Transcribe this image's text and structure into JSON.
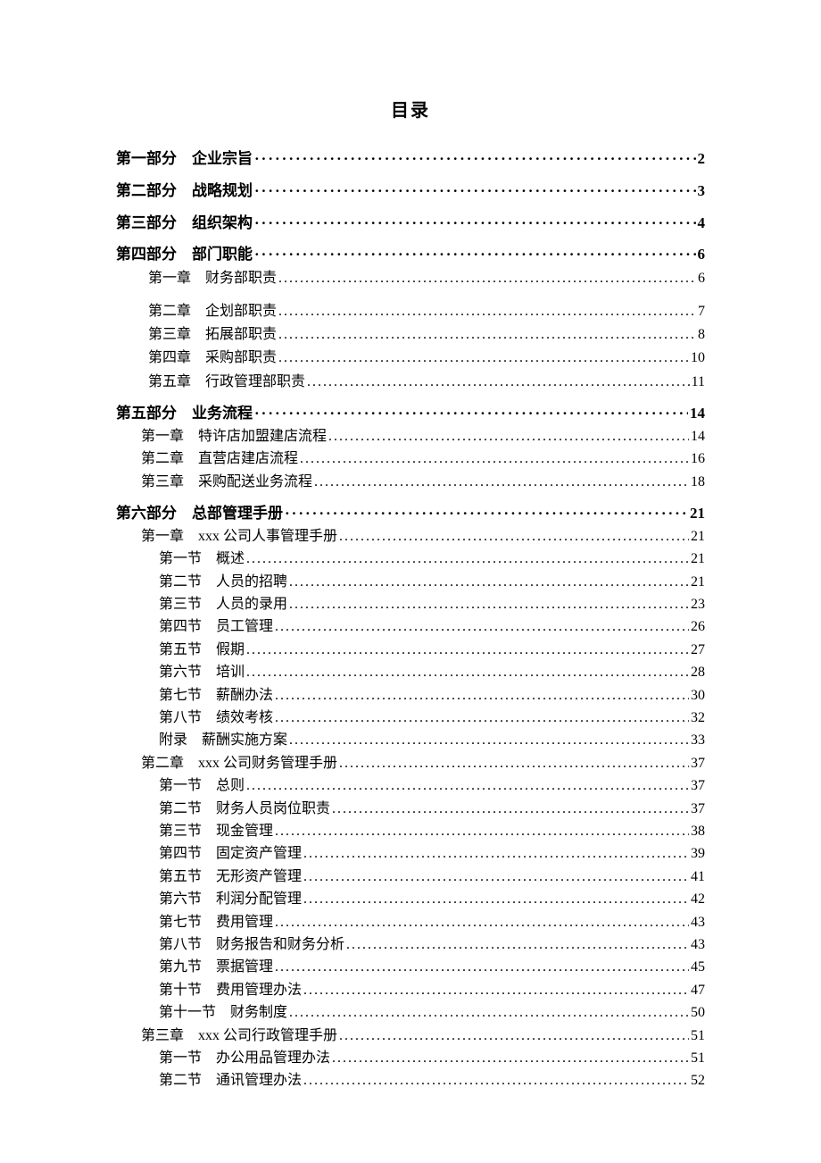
{
  "title": "目录",
  "entries": [
    {
      "level": "lvl1",
      "bold": true,
      "label": "第一部分　企业宗旨",
      "page": "2"
    },
    {
      "level": "lvl1",
      "bold": true,
      "label": "第二部分　战略规划",
      "page": "3"
    },
    {
      "level": "lvl1",
      "bold": true,
      "label": "第三部分　组织架构",
      "page": "4"
    },
    {
      "level": "lvl1",
      "bold": true,
      "label": "第四部分　部门职能",
      "page": "6"
    },
    {
      "level": "lvl1b",
      "bold": false,
      "label": "第一章　财务部职责",
      "page": "6",
      "gapAfter": true
    },
    {
      "level": "lvl1b",
      "bold": false,
      "label": "第二章　企划部职责",
      "page": "7"
    },
    {
      "level": "lvl1b",
      "bold": false,
      "label": "第三章　拓展部职责",
      "page": "8"
    },
    {
      "level": "lvl1b",
      "bold": false,
      "label": "第四章　采购部职责",
      "page": "10"
    },
    {
      "level": "lvl1b",
      "bold": false,
      "label": "第五章　行政管理部职责",
      "page": "11"
    },
    {
      "level": "lvl1",
      "bold": true,
      "label": "第五部分　业务流程",
      "page": "14"
    },
    {
      "level": "lvl2",
      "bold": false,
      "label": "第一章　特许店加盟建店流程",
      "page": "14"
    },
    {
      "level": "lvl2",
      "bold": false,
      "label": "第二章　直营店建店流程",
      "page": "16"
    },
    {
      "level": "lvl2",
      "bold": false,
      "label": "第三章　采购配送业务流程",
      "page": "18"
    },
    {
      "level": "lvl1",
      "bold": true,
      "label": "第六部分　总部管理手册",
      "page": "21"
    },
    {
      "level": "lvl2",
      "bold": false,
      "label": "第一章　xxx 公司人事管理手册",
      "page": "21"
    },
    {
      "level": "lvl3",
      "bold": false,
      "label": "第一节　概述",
      "page": "21"
    },
    {
      "level": "lvl3",
      "bold": false,
      "label": "第二节　人员的招聘",
      "page": "21"
    },
    {
      "level": "lvl3",
      "bold": false,
      "label": "第三节　人员的录用",
      "page": "23"
    },
    {
      "level": "lvl3",
      "bold": false,
      "label": "第四节　员工管理",
      "page": "26"
    },
    {
      "level": "lvl3",
      "bold": false,
      "label": "第五节　假期",
      "page": "27"
    },
    {
      "level": "lvl3",
      "bold": false,
      "label": "第六节　培训",
      "page": "28"
    },
    {
      "level": "lvl3",
      "bold": false,
      "label": "第七节　薪酬办法",
      "page": "30"
    },
    {
      "level": "lvl3",
      "bold": false,
      "label": "第八节　绩效考核",
      "page": "32"
    },
    {
      "level": "lvl3",
      "bold": false,
      "label": "附录　薪酬实施方案",
      "page": "33"
    },
    {
      "level": "lvl2",
      "bold": false,
      "label": "第二章　xxx 公司财务管理手册",
      "page": "37"
    },
    {
      "level": "lvl3",
      "bold": false,
      "label": "第一节　总则",
      "page": "37"
    },
    {
      "level": "lvl3",
      "bold": false,
      "label": "第二节　财务人员岗位职责",
      "page": "37"
    },
    {
      "level": "lvl3",
      "bold": false,
      "label": "第三节　现金管理",
      "page": "38"
    },
    {
      "level": "lvl3",
      "bold": false,
      "label": "第四节　固定资产管理",
      "page": "39"
    },
    {
      "level": "lvl3",
      "bold": false,
      "label": "第五节　无形资产管理",
      "page": "41"
    },
    {
      "level": "lvl3",
      "bold": false,
      "label": "第六节　利润分配管理",
      "page": "42"
    },
    {
      "level": "lvl3",
      "bold": false,
      "label": "第七节　费用管理",
      "page": "43"
    },
    {
      "level": "lvl3",
      "bold": false,
      "label": "第八节　财务报告和财务分析",
      "page": "43"
    },
    {
      "level": "lvl3",
      "bold": false,
      "label": "第九节　票据管理",
      "page": "45"
    },
    {
      "level": "lvl3",
      "bold": false,
      "label": "第十节　费用管理办法",
      "page": "47"
    },
    {
      "level": "lvl3",
      "bold": false,
      "label": "第十一节　财务制度",
      "page": "50"
    },
    {
      "level": "lvl2",
      "bold": false,
      "label": "第三章　xxx 公司行政管理手册",
      "page": "51"
    },
    {
      "level": "lvl3",
      "bold": false,
      "label": "第一节　办公用品管理办法",
      "page": "51"
    },
    {
      "level": "lvl3",
      "bold": false,
      "label": "第二节　通讯管理办法",
      "page": "52"
    }
  ]
}
